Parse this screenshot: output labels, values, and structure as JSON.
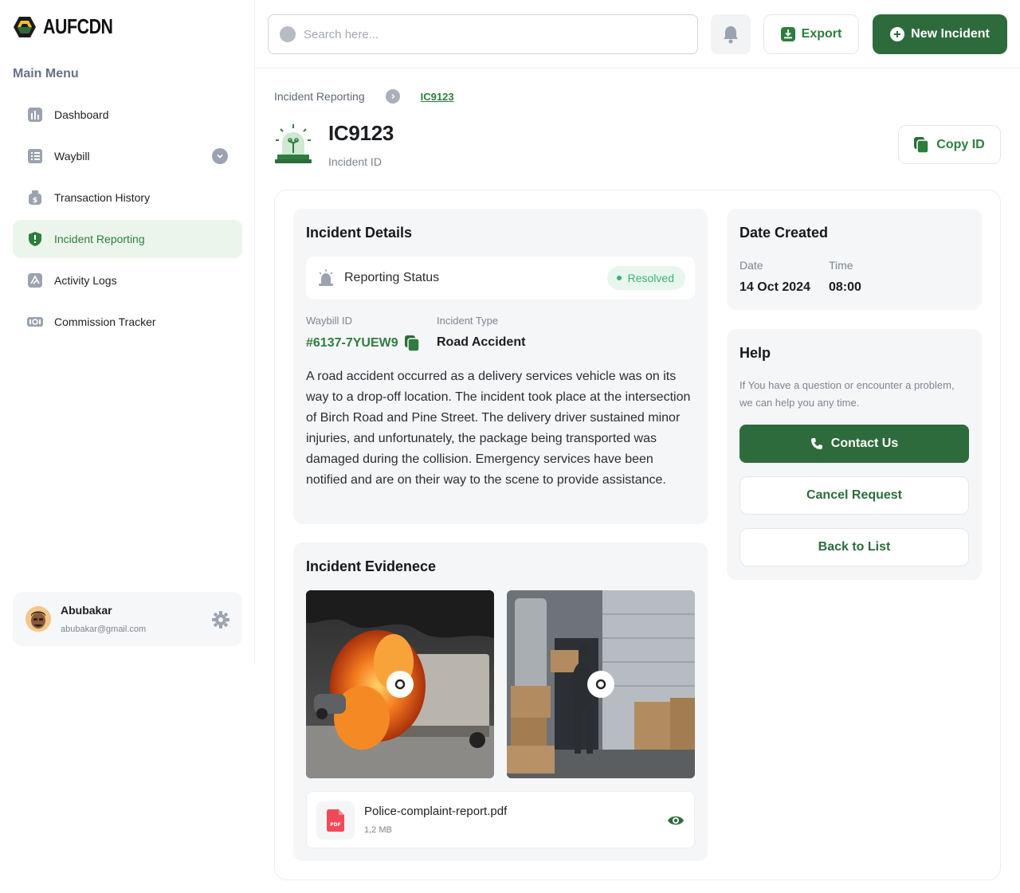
{
  "brand": {
    "name": "AUFCDN",
    "accent": "#2e6b3c",
    "accent_light": "#ecf5ec"
  },
  "sidebar": {
    "menu_title": "Main Menu",
    "items": [
      {
        "label": "Dashboard",
        "icon": "bar-chart-icon"
      },
      {
        "label": "Waybill",
        "icon": "list-icon",
        "has_chevron": true
      },
      {
        "label": "Transaction History",
        "icon": "money-bag-icon"
      },
      {
        "label": "Incident Reporting",
        "icon": "shield-alert-icon",
        "active": true
      },
      {
        "label": "Activity Logs",
        "icon": "activity-icon"
      },
      {
        "label": "Commission Tracker",
        "icon": "cash-icon"
      }
    ],
    "profile": {
      "name": "Abubakar",
      "email": "abubakar@gmail.com"
    }
  },
  "topbar": {
    "search_placeholder": "Search here...",
    "export_label": "Export",
    "new_incident_label": "New Incident"
  },
  "breadcrumb": {
    "parent": "Incident Reporting",
    "current": "IC9123"
  },
  "incident": {
    "id": "IC9123",
    "id_label": "Incident ID",
    "copy_label": "Copy ID",
    "details": {
      "title": "Incident Details",
      "status_label": "Reporting Status",
      "status_value": "Resolved",
      "waybill_label": "Waybill ID",
      "waybill_value": "#6137-7YUEW9",
      "type_label": "Incident Type",
      "type_value": "Road Accident",
      "description": "A road accident occurred as a delivery services vehicle was on its way to a drop-off location. The incident took place at the intersection of Birch Road and Pine Street. The delivery driver sustained minor injuries, and unfortunately, the package being transported was damaged during the collision. Emergency services have been notified and are on their way to the scene to provide assistance."
    },
    "evidence": {
      "title": "Incident Evidenece",
      "file_name": "Police-complaint-report.pdf",
      "file_size": "1,2 MB",
      "file_type": "PDF"
    },
    "date_created": {
      "title": "Date Created",
      "date_label": "Date",
      "date_value": "14 Oct 2024",
      "time_label": "Time",
      "time_value": "08:00"
    },
    "help": {
      "title": "Help",
      "text": "If You have a question or encounter a problem, we can help you any time.",
      "contact_label": "Contact Us",
      "cancel_label": "Cancel Request",
      "back_label": "Back to List"
    }
  }
}
